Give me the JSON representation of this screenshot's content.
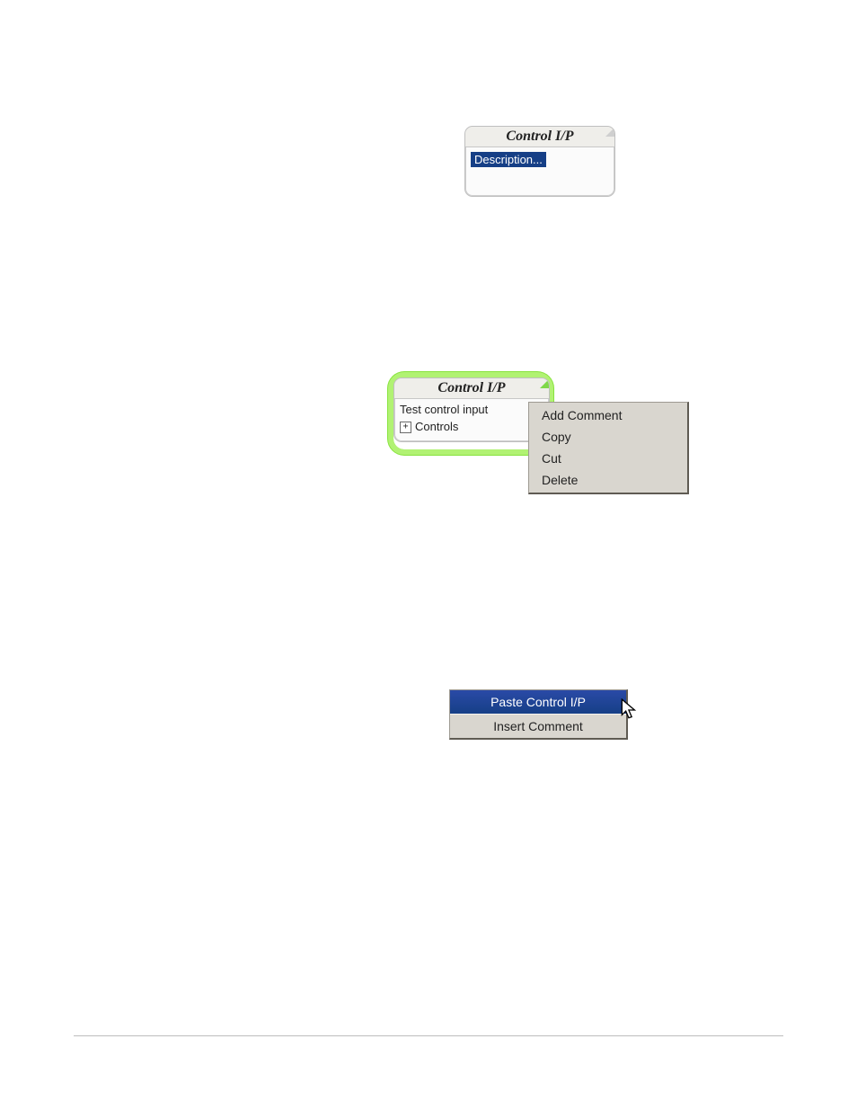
{
  "fig1": {
    "block_title": "Control I/P",
    "highlighted_item": "Description..."
  },
  "fig2": {
    "block_title": "Control I/P",
    "body_line1": "Test control input",
    "plus_symbol": "+",
    "tree_label": "Controls",
    "context_menu": {
      "items": [
        {
          "label": "Add Comment"
        },
        {
          "label": "Copy"
        },
        {
          "label": "Cut"
        },
        {
          "label": "Delete"
        }
      ]
    }
  },
  "fig3": {
    "context_menu": {
      "items": [
        {
          "label": "Paste Control I/P",
          "selected": true
        },
        {
          "label": "Insert Comment",
          "selected": false
        }
      ]
    }
  }
}
